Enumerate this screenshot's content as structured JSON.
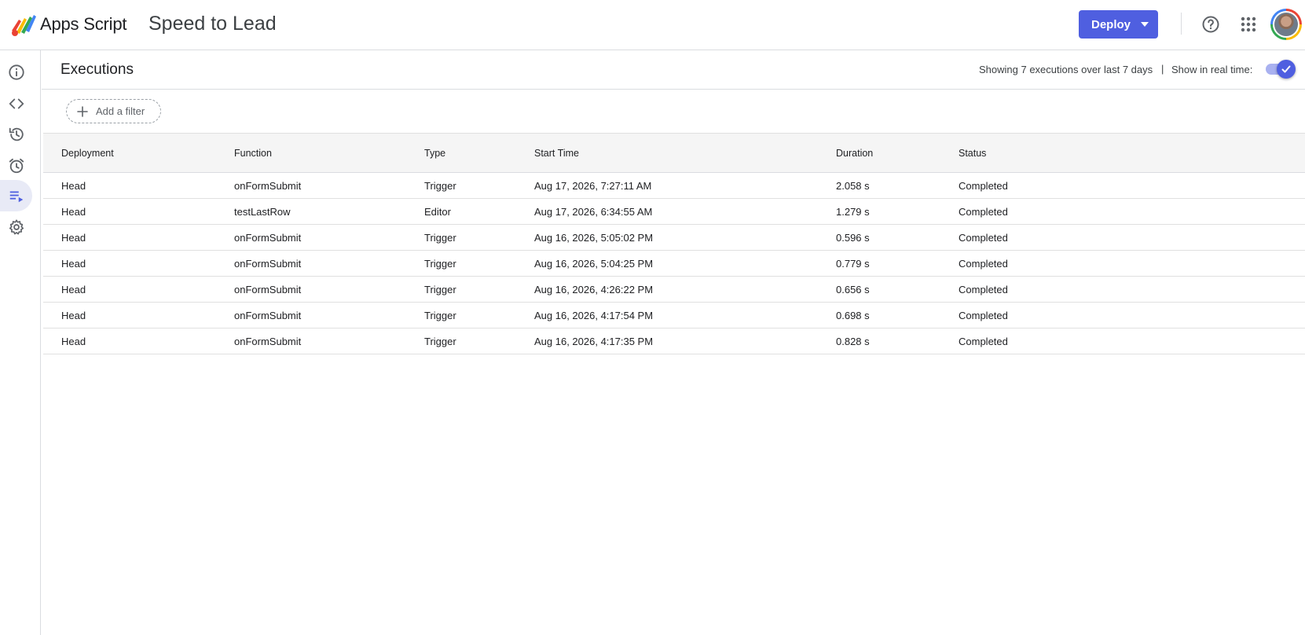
{
  "header": {
    "app_name": "Apps Script",
    "project_name": "Speed to Lead",
    "deploy_label": "Deploy"
  },
  "rail": {
    "items": [
      {
        "icon": "info-icon"
      },
      {
        "icon": "code-icon"
      },
      {
        "icon": "history-icon"
      },
      {
        "icon": "alarm-icon"
      },
      {
        "icon": "executions-icon",
        "active": true
      },
      {
        "icon": "gear-icon"
      }
    ]
  },
  "page": {
    "title": "Executions",
    "summary": "Showing 7 executions over last 7 days",
    "separator": "|",
    "realtime_label": "Show in real time:",
    "realtime_on": true,
    "add_filter_label": "Add a filter"
  },
  "table": {
    "columns": [
      "Deployment",
      "Function",
      "Type",
      "Start Time",
      "Duration",
      "Status"
    ],
    "rows": [
      [
        "Head",
        "onFormSubmit",
        "Trigger",
        "Aug 17, 2026, 7:27:11 AM",
        "2.058 s",
        "Completed"
      ],
      [
        "Head",
        "testLastRow",
        "Editor",
        "Aug 17, 2026, 6:34:55 AM",
        "1.279 s",
        "Completed"
      ],
      [
        "Head",
        "onFormSubmit",
        "Trigger",
        "Aug 16, 2026, 5:05:02 PM",
        "0.596 s",
        "Completed"
      ],
      [
        "Head",
        "onFormSubmit",
        "Trigger",
        "Aug 16, 2026, 5:04:25 PM",
        "0.779 s",
        "Completed"
      ],
      [
        "Head",
        "onFormSubmit",
        "Trigger",
        "Aug 16, 2026, 4:26:22 PM",
        "0.656 s",
        "Completed"
      ],
      [
        "Head",
        "onFormSubmit",
        "Trigger",
        "Aug 16, 2026, 4:17:54 PM",
        "0.698 s",
        "Completed"
      ],
      [
        "Head",
        "onFormSubmit",
        "Trigger",
        "Aug 16, 2026, 4:17:35 PM",
        "0.828 s",
        "Completed"
      ]
    ]
  },
  "colors": {
    "accent": "#4f5fe0",
    "active_rail_bg": "#e8eaf6",
    "header_row_bg": "#f5f5f5",
    "border": "#dadce0"
  }
}
